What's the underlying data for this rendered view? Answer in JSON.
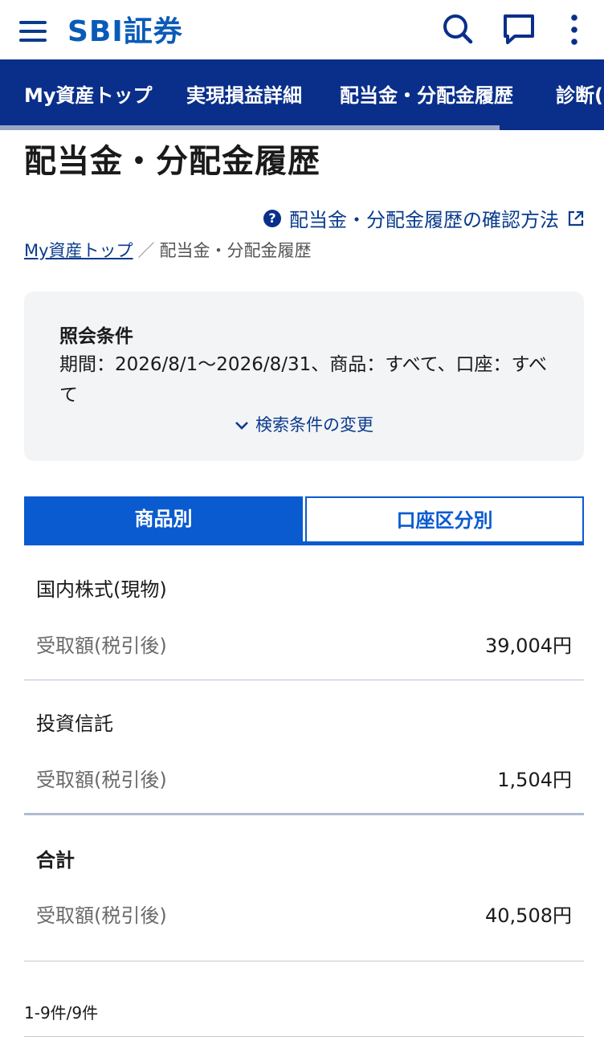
{
  "header": {
    "logo_text": "SBI証券",
    "icons": [
      "menu-icon",
      "search-icon",
      "chat-icon",
      "more-icon"
    ],
    "brand_color": "#0a5bb8"
  },
  "nav": {
    "items": [
      "My資産トップ",
      "実現損益詳細",
      "配当金・分配金履歴",
      "診断("
    ],
    "background": "#0a2f8a"
  },
  "page": {
    "title": "配当金・分配金履歴",
    "help_link": "配当金・分配金履歴の確認方法"
  },
  "breadcrumb": {
    "home": "My資産トップ",
    "separator": "／",
    "current": "配当金・分配金履歴"
  },
  "conditions": {
    "heading": "照会条件",
    "text": "期間：2026/8/1〜2026/8/31、商品：すべて、口座：すべて",
    "change_label": "検索条件の変更"
  },
  "tabs": {
    "active": "商品別",
    "inactive": "口座区分別"
  },
  "rows": [
    {
      "title": "国内株式(現物)",
      "label": "受取額(税引後)",
      "value": "39,004円"
    },
    {
      "title": "投資信託",
      "label": "受取額(税引後)",
      "value": "1,504円"
    }
  ],
  "total": {
    "title": "合計",
    "label": "受取額(税引後)",
    "value": "40,508円"
  },
  "count": "1-9件/9件"
}
